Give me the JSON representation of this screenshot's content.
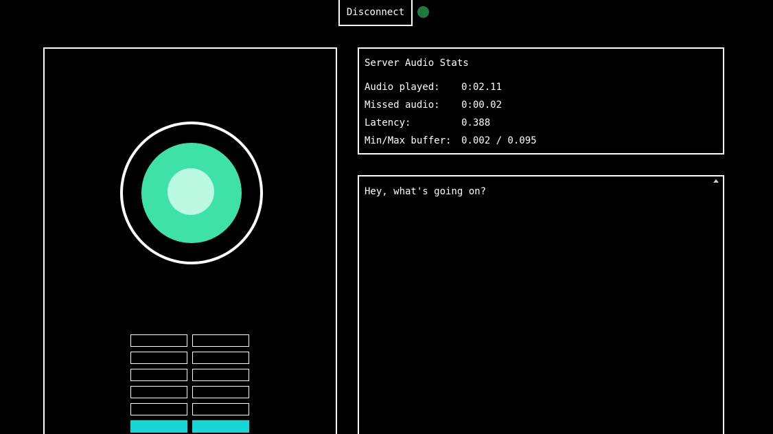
{
  "header": {
    "disconnect_label": "Disconnect",
    "status": "connected",
    "status_color": "#1e7a3c"
  },
  "visualizer": {
    "ring_color": "#ffffff",
    "mid_color": "#3ee2a8",
    "core_color": "#bbfae0"
  },
  "meters": {
    "left_levels": [
      false,
      false,
      false,
      false,
      false,
      true
    ],
    "right_levels": [
      false,
      false,
      false,
      false,
      false,
      true
    ],
    "active_color": "#18d6d6"
  },
  "stats": {
    "title": "Server Audio Stats",
    "rows": [
      {
        "label": "Audio played:",
        "value": "0:02.11"
      },
      {
        "label": "Missed audio:",
        "value": "0:00.02"
      },
      {
        "label": "Latency:",
        "value": "0.388"
      },
      {
        "label": "Min/Max buffer:",
        "value": "0.002 / 0.095"
      }
    ]
  },
  "chat": {
    "text": "Hey, what's going on?"
  }
}
